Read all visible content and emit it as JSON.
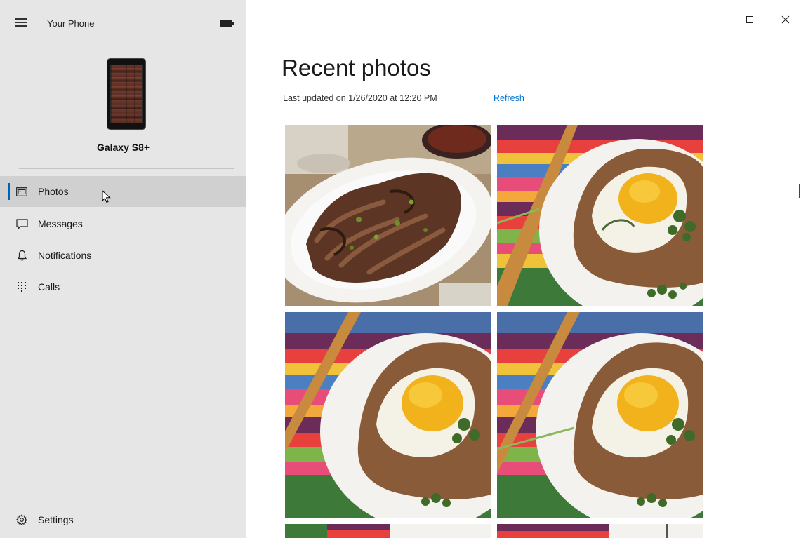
{
  "app": {
    "title": "Your Phone",
    "window_controls": [
      "minimize",
      "maximize",
      "close"
    ]
  },
  "device": {
    "name": "Galaxy S8+",
    "image": "phone-thumbnail"
  },
  "nav": [
    {
      "label": "Photos",
      "icon": "photos-icon",
      "active": true
    },
    {
      "label": "Messages",
      "icon": "message-icon",
      "active": false
    },
    {
      "label": "Notifications",
      "icon": "bell-icon",
      "active": false
    },
    {
      "label": "Calls",
      "icon": "dialpad-icon",
      "active": false
    }
  ],
  "settings": {
    "label": "Settings",
    "icon": "gear-icon"
  },
  "main": {
    "heading": "Recent photos",
    "last_updated": "Last updated on 1/26/2020 at 12:20 PM",
    "refresh_label": "Refresh",
    "photos": [
      {
        "subject": "plate-of-braised-meat"
      },
      {
        "subject": "egg-in-toast"
      },
      {
        "subject": "egg-in-toast"
      },
      {
        "subject": "egg-in-toast"
      },
      {
        "subject": "partial-photo"
      },
      {
        "subject": "partial-photo"
      }
    ]
  },
  "colors": {
    "accent": "#0078d7",
    "sidebar_bg": "#e6e6e6",
    "active_item_bg": "#d0d0d0"
  }
}
